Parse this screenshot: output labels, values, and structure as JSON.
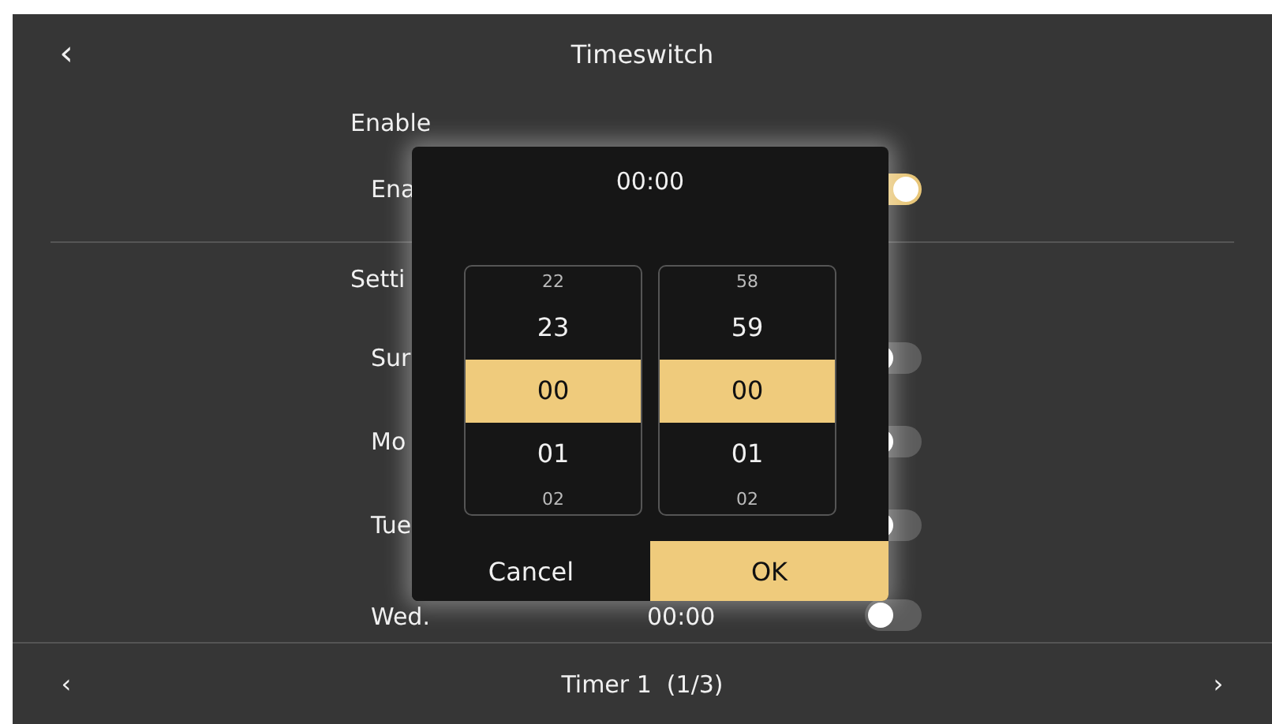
{
  "header": {
    "back": "‹",
    "title": "Timeswitch"
  },
  "sections": [
    {
      "label": "Enable",
      "rows": [
        {
          "label": "Ena",
          "on": true
        }
      ]
    },
    {
      "label": "Setti",
      "rows": [
        {
          "label": "Sur",
          "on": false
        },
        {
          "label": "Mo",
          "on": false
        },
        {
          "label": "Tue",
          "on": false
        },
        {
          "label": "Wed.",
          "time": "00:00",
          "on": false
        }
      ]
    }
  ],
  "footer": {
    "prev": "‹",
    "title": "Timer 1  (1/3)",
    "next": "›"
  },
  "dialog": {
    "title": "00:00",
    "wheels": [
      {
        "items": [
          {
            "label": "22",
            "selected": false
          },
          {
            "label": "23",
            "selected": false
          },
          {
            "label": "00",
            "selected": true
          },
          {
            "label": "01",
            "selected": false
          },
          {
            "label": "02",
            "selected": false
          }
        ]
      },
      {
        "items": [
          {
            "label": "58",
            "selected": false
          },
          {
            "label": "59",
            "selected": false
          },
          {
            "label": "00",
            "selected": true
          },
          {
            "label": "01",
            "selected": false
          },
          {
            "label": "02",
            "selected": false
          }
        ]
      }
    ],
    "buttons": [
      {
        "label": "Cancel",
        "primary": false
      },
      {
        "label": "OK",
        "primary": true
      }
    ]
  }
}
